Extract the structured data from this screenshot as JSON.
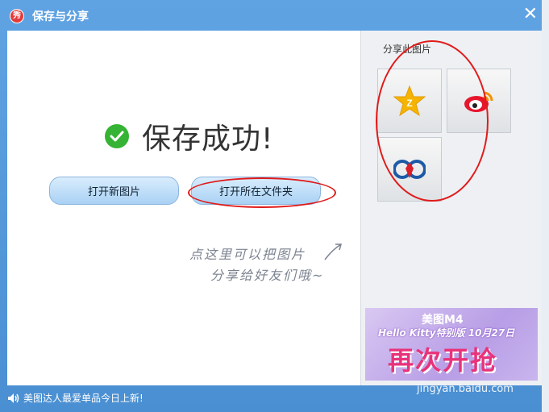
{
  "window": {
    "title": "保存与分享",
    "app_icon_text": "秀",
    "close_symbol": "✕"
  },
  "main": {
    "success_text": "保存成功!",
    "open_new_button": "打开新图片",
    "open_folder_button": "打开所在文件夹",
    "hint_line1": "点这里可以把图片",
    "hint_line2": "分享给好友们哦~"
  },
  "share": {
    "label": "分享此图片",
    "targets": [
      "qzone-share",
      "weibo-share",
      "renren-share"
    ]
  },
  "banner": {
    "brand": "美图M4",
    "subtitle": "Hello Kitty特别版 10月27日",
    "headline": "再次开抢"
  },
  "statusbar": {
    "message": "美图达人最爱单品今日上新!",
    "watermark": "jingyan.baidu.com"
  },
  "colors": {
    "titlebar": "#5fa3e3",
    "success_green": "#35b334",
    "annotation_red": "#e01b1b"
  }
}
